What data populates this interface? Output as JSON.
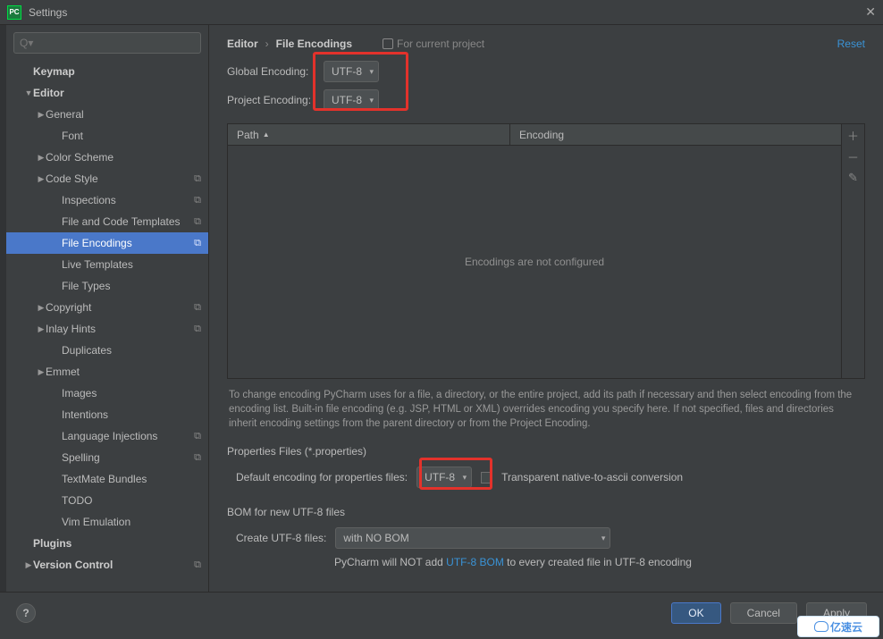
{
  "window": {
    "title": "Settings"
  },
  "search": {
    "placeholder": "Q▾"
  },
  "tree": {
    "keymap": "Keymap",
    "editor": "Editor",
    "general": "General",
    "font": "Font",
    "color_scheme": "Color Scheme",
    "code_style": "Code Style",
    "inspections": "Inspections",
    "file_code_templates": "File and Code Templates",
    "file_encodings": "File Encodings",
    "live_templates": "Live Templates",
    "file_types": "File Types",
    "copyright": "Copyright",
    "inlay_hints": "Inlay Hints",
    "duplicates": "Duplicates",
    "emmet": "Emmet",
    "images": "Images",
    "intentions": "Intentions",
    "language_injections": "Language Injections",
    "spelling": "Spelling",
    "textmate_bundles": "TextMate Bundles",
    "todo": "TODO",
    "vim_emulation": "Vim Emulation",
    "plugins": "Plugins",
    "version_control": "Version Control"
  },
  "breadcrumb": {
    "root": "Editor",
    "leaf": "File Encodings",
    "note": "For current project",
    "reset": "Reset"
  },
  "fields": {
    "global_encoding_label": "Global Encoding:",
    "global_encoding_value": "UTF-8",
    "project_encoding_label": "Project Encoding:",
    "project_encoding_value": "UTF-8"
  },
  "table": {
    "col_path": "Path",
    "col_encoding": "Encoding",
    "empty_msg": "Encodings are not configured"
  },
  "help_text": "To change encoding PyCharm uses for a file, a directory, or the entire project, add its path if necessary and then select encoding from the encoding list. Built-in file encoding (e.g. JSP, HTML or XML) overrides encoding you specify here. If not specified, files and directories inherit encoding settings from the parent directory or from the Project Encoding.",
  "properties": {
    "section": "Properties Files (*.properties)",
    "default_label": "Default encoding for properties files:",
    "default_value": "UTF-8",
    "transparent_label": "Transparent native-to-ascii conversion"
  },
  "bom": {
    "section": "BOM for new UTF-8 files",
    "create_label": "Create UTF-8 files:",
    "create_value": "with NO BOM",
    "note_prefix": "PyCharm will NOT add ",
    "note_link": "UTF-8 BOM",
    "note_suffix": " to every created file in UTF-8 encoding"
  },
  "footer": {
    "ok": "OK",
    "cancel": "Cancel",
    "apply": "Apply",
    "help": "?"
  },
  "watermark": "亿速云"
}
